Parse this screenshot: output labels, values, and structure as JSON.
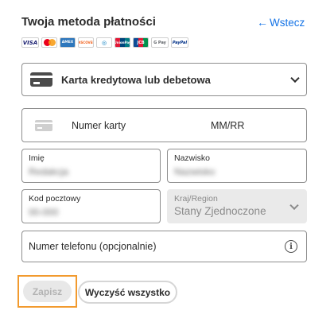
{
  "header": {
    "title": "Twoja metoda płatności",
    "back_label": "Wstecz",
    "back_arrow": "←"
  },
  "payment_logos": [
    {
      "name": "visa",
      "text": "VISA"
    },
    {
      "name": "mastercard",
      "text": ""
    },
    {
      "name": "amex",
      "text": "AMEX"
    },
    {
      "name": "discover",
      "text": "DISCOVER"
    },
    {
      "name": "diners",
      "text": "◎"
    },
    {
      "name": "unionpay",
      "text": "UnionPay"
    },
    {
      "name": "jcb",
      "text": "JCB"
    },
    {
      "name": "gpay",
      "text": "G Pay"
    },
    {
      "name": "paypal",
      "text": "PayPal"
    }
  ],
  "method_select": {
    "value": "Karta kredytowa lub debetowa"
  },
  "card_number": {
    "placeholder": "Numer karty",
    "expiry_placeholder": "MM/RR"
  },
  "first_name": {
    "label": "Imię",
    "value": "Redakcja"
  },
  "last_name": {
    "label": "Nazwisko",
    "value": "Nazwisko"
  },
  "postal_code": {
    "label": "Kod pocztowy",
    "value": "00-000"
  },
  "country": {
    "label": "Kraj/Region",
    "value": "Stany Zjednoczone"
  },
  "phone": {
    "placeholder": "Numer telefonu (opcjonalnie)",
    "info_glyph": "i"
  },
  "actions": {
    "save_label": "Zapisz",
    "clear_label": "Wyczyść wszystko"
  },
  "colors": {
    "accent": "#1473e6",
    "focus_outline": "#f29a2e",
    "disabled_bg": "#eaeaea"
  }
}
